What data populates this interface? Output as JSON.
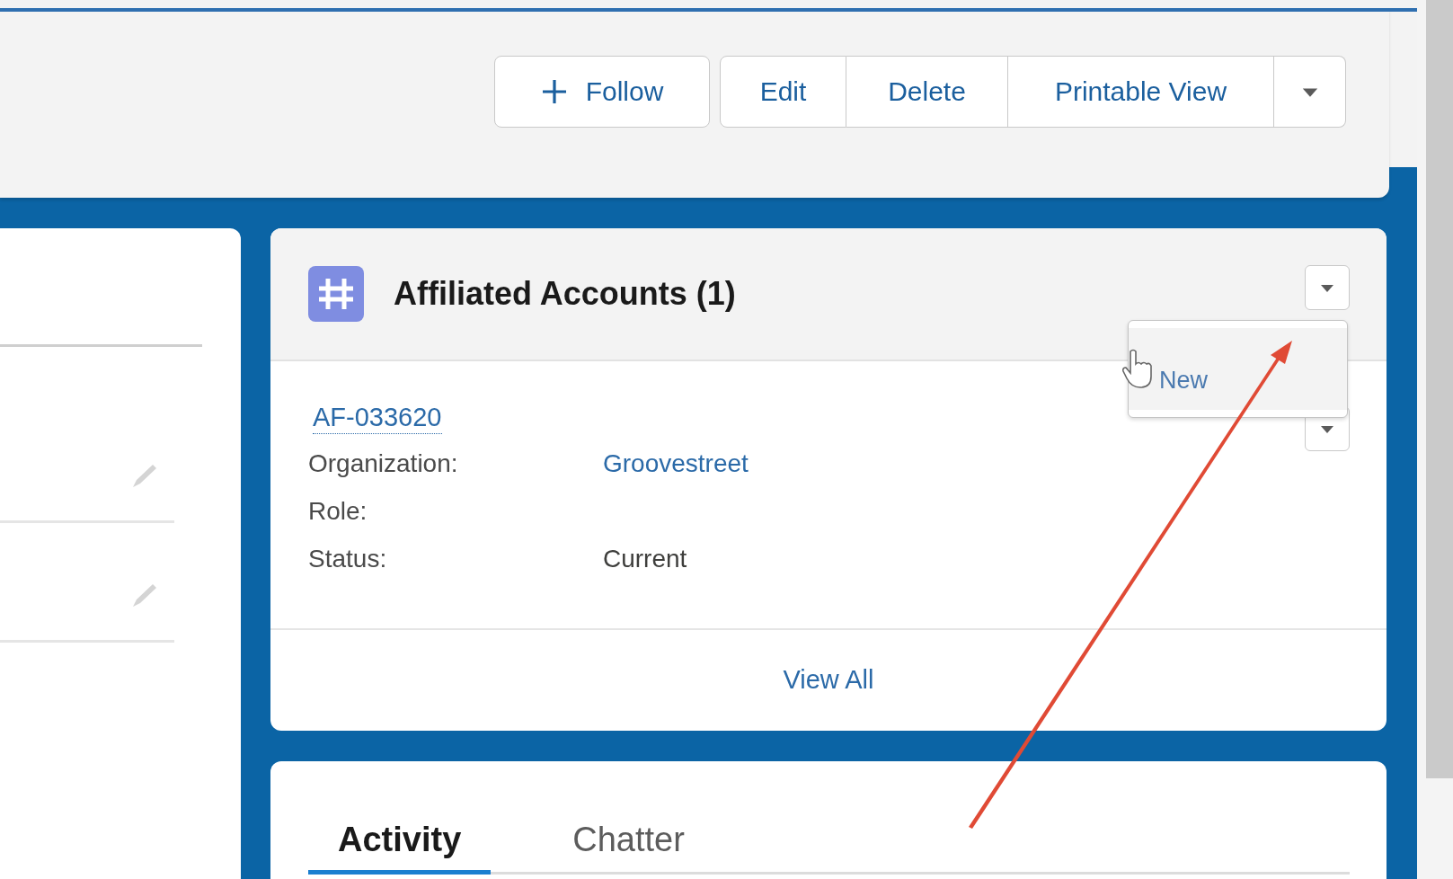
{
  "actions": {
    "follow": {
      "label": "Follow"
    },
    "buttons": [
      {
        "label": "Edit"
      },
      {
        "label": "Delete"
      },
      {
        "label": "Printable View"
      }
    ]
  },
  "related_list": {
    "title": "Affiliated Accounts (1)",
    "menu": {
      "open": true,
      "items": [
        {
          "label": "New",
          "hovered": true
        }
      ]
    },
    "records": [
      {
        "name": "AF-033620",
        "fields": [
          {
            "label": "Organization:",
            "value": "Groovestreet",
            "kind": "link"
          },
          {
            "label": "Role:"
          },
          {
            "label": "Status:",
            "value": "Current",
            "kind": "text"
          }
        ]
      }
    ],
    "footer_link": "View All"
  },
  "tabs": [
    {
      "label": "Activity",
      "selected": true
    },
    {
      "label": "Chatter",
      "selected": false
    }
  ]
}
